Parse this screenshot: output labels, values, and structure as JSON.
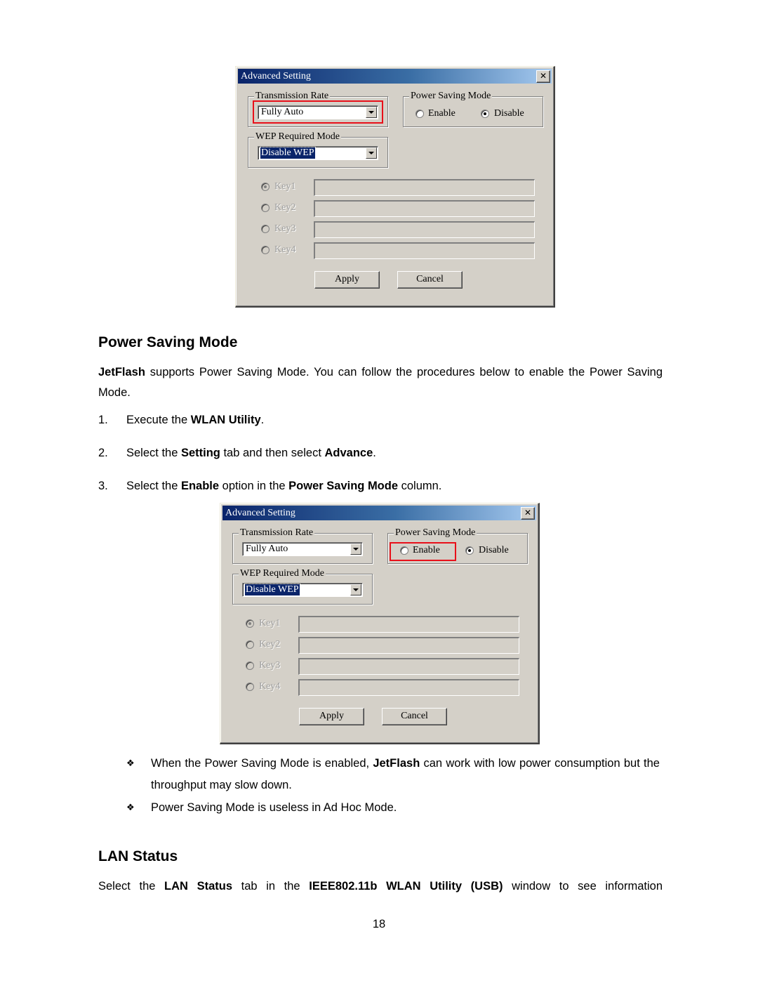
{
  "dialogs": [
    {
      "title": "Advanced Setting",
      "close_glyph": "✕",
      "transmission_rate": {
        "label": "Transmission Rate",
        "value": "Fully Auto"
      },
      "power_saving": {
        "label": "Power Saving Mode",
        "enable": "Enable",
        "disable": "Disable",
        "selected": "Disable"
      },
      "wep": {
        "label": "WEP Required Mode",
        "value": "Disable WEP"
      },
      "keys": [
        "Key1",
        "Key2",
        "Key3",
        "Key4"
      ],
      "apply": "Apply",
      "cancel": "Cancel",
      "highlight": "transmission-rate-combo"
    },
    {
      "title": "Advanced Setting",
      "close_glyph": "✕",
      "transmission_rate": {
        "label": "Transmission Rate",
        "value": "Fully Auto"
      },
      "power_saving": {
        "label": "Power Saving Mode",
        "enable": "Enable",
        "disable": "Disable",
        "selected": "Disable"
      },
      "wep": {
        "label": "WEP Required Mode",
        "value": "Disable WEP"
      },
      "keys": [
        "Key1",
        "Key2",
        "Key3",
        "Key4"
      ],
      "apply": "Apply",
      "cancel": "Cancel",
      "highlight": "enable-radio"
    }
  ],
  "section_power": {
    "heading": "Power Saving Mode",
    "intro_bold": "JetFlash",
    "intro_rest": " supports Power Saving Mode. You can follow the procedures below to enable the Power Saving Mode.",
    "steps": [
      {
        "num": "1.",
        "parts": [
          "Execute the ",
          "WLAN Utility",
          "."
        ]
      },
      {
        "num": "2.",
        "parts": [
          "Select the ",
          "Setting",
          " tab and then select ",
          "Advance",
          "."
        ]
      },
      {
        "num": "3.",
        "parts": [
          "Select the ",
          "Enable",
          " option in the ",
          "Power Saving Mode",
          " column."
        ]
      }
    ],
    "bullet_mark": "❖",
    "notes": [
      {
        "pre": "When the Power Saving Mode is enabled, ",
        "bold": "JetFlash",
        "post": " can work with low power consumption but the throughput may slow down."
      },
      {
        "pre": "Power Saving Mode is useless in Ad Hoc Mode.",
        "bold": "",
        "post": ""
      }
    ]
  },
  "section_lan": {
    "heading": "LAN Status",
    "parts": [
      "Select the ",
      "LAN Status",
      " tab in the ",
      "IEEE802.11b WLAN Utility (USB)",
      " window to see information"
    ]
  },
  "page_number": "18",
  "colors": {
    "highlight": "#e8101a",
    "title_start": "#0a246a",
    "title_end": "#a6caf0",
    "dialog_bg": "#d4d0c8"
  }
}
